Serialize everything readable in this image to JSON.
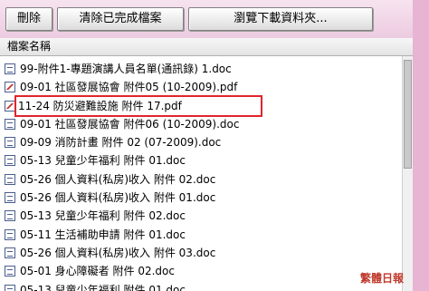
{
  "toolbar": {
    "delete_label": "刪除",
    "clear_label": "清除已完成檔案",
    "browse_label": "瀏覽下載資料夾..."
  },
  "list": {
    "header": "檔案名稱",
    "items": [
      {
        "name": "99-附件1-專題演講人員名單(通訊錄) 1.doc",
        "type": "doc"
      },
      {
        "name": "09-01 社區發展協會 附件05 (10-2009).pdf",
        "type": "pdf"
      },
      {
        "name": "11-24 防災避難設施 附件 17.pdf",
        "type": "pdf",
        "selected": true
      },
      {
        "name": "09-01 社區發展協會 附件06 (10-2009).doc",
        "type": "doc"
      },
      {
        "name": "09-09 消防計畫 附件 02 (07-2009).doc",
        "type": "doc"
      },
      {
        "name": "05-13 兒童少年福利 附件 01.doc",
        "type": "doc"
      },
      {
        "name": "05-26 個人資料(私房)收入 附件 02.doc",
        "type": "doc"
      },
      {
        "name": "05-26 個人資料(私房)收入 附件 01.doc",
        "type": "doc"
      },
      {
        "name": "05-13 兒童少年福利 附件 02.doc",
        "type": "doc"
      },
      {
        "name": "05-11 生活補助申請 附件 01.doc",
        "type": "doc"
      },
      {
        "name": "05-26 個人資料(私房)收入 附件 03.doc",
        "type": "doc"
      },
      {
        "name": "05-01 身心障礙者 附件 02.doc",
        "type": "doc"
      },
      {
        "name": "05-13 兒童少年福利 附件 01.doc",
        "type": "doc"
      }
    ]
  },
  "watermark": "繁體日報"
}
